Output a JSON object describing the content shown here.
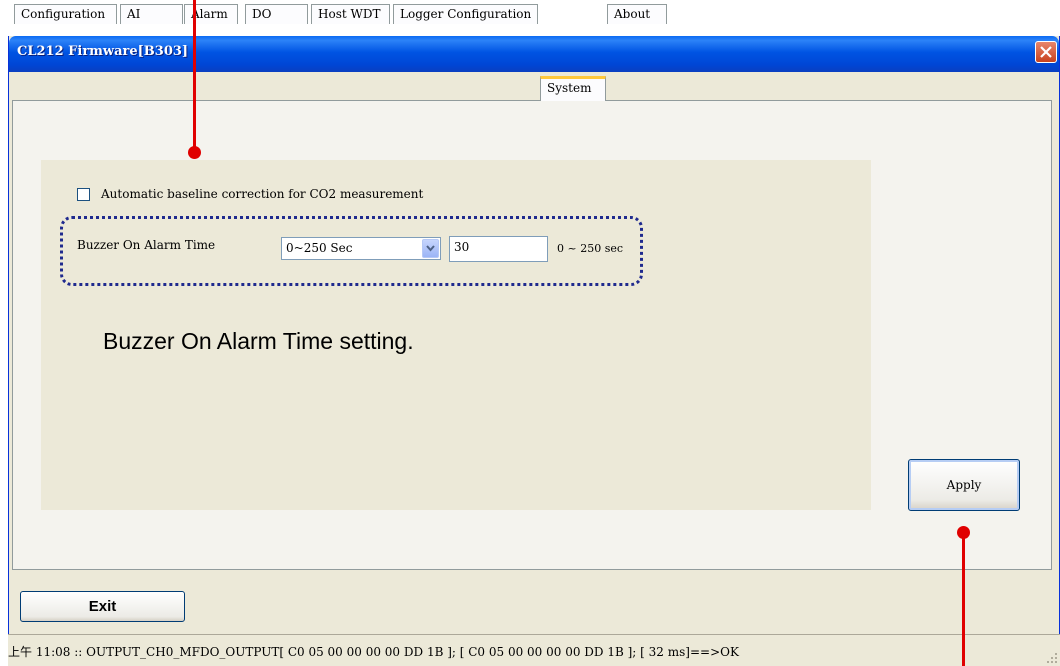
{
  "window": {
    "title": "CL212 Firmware[B303]"
  },
  "tabs": [
    {
      "label": "Configuration"
    },
    {
      "label": "AI"
    },
    {
      "label": "Alarm"
    },
    {
      "label": "DO"
    },
    {
      "label": "Host WDT"
    },
    {
      "label": "Logger Configuration"
    },
    {
      "label": "System"
    },
    {
      "label": "About"
    }
  ],
  "active_tab": "System",
  "system": {
    "checkbox_label": "Automatic baseline correction for CO2 measurement",
    "checkbox_checked": false,
    "buzzer_label": "Buzzer On Alarm Time",
    "buzzer_select_value": "0~250 Sec",
    "buzzer_value": "30",
    "buzzer_range": "0 ~ 250 sec",
    "apply_label": "Apply"
  },
  "annotation": "Buzzer On Alarm Time setting.",
  "footer": {
    "exit_label": "Exit",
    "status_text": "上午 11:08 :: OUTPUT_CH0_MFDO_OUTPUT[ C0 05 00 00 00 00 DD 1B ]; [ C0 05 00 00 00 00 DD 1B  ]; [ 32 ms]==>OK"
  },
  "colors": {
    "titlebar": "#0054E3",
    "window_bg": "#ECE9D8",
    "callout": "#E00000",
    "dotted_outline": "#1F2A8E",
    "active_tab_accent": "#FFC83C"
  }
}
